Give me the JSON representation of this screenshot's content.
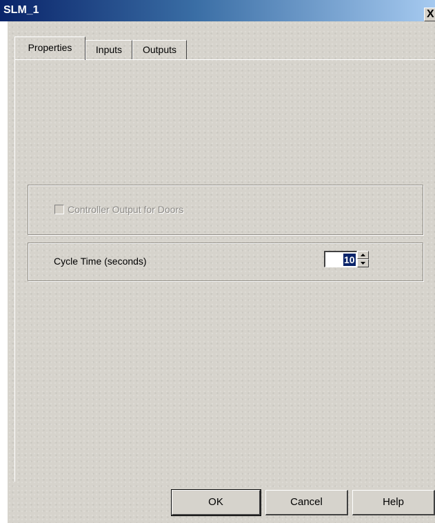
{
  "window": {
    "title": "SLM_1",
    "close_symbol": "X"
  },
  "tabs": [
    {
      "label": "Properties",
      "active": true
    },
    {
      "label": "Inputs",
      "active": false
    },
    {
      "label": "Outputs",
      "active": false
    }
  ],
  "properties": {
    "controller_output_label": "Controller Output for Doors",
    "controller_output_checked": false,
    "controller_output_enabled": false,
    "cycle_time_label": "Cycle Time (seconds)",
    "cycle_time_value": "10"
  },
  "buttons": {
    "ok": "OK",
    "cancel": "Cancel",
    "help": "Help"
  },
  "icons": {
    "spin_up": "triangle-up-icon",
    "spin_down": "triangle-down-icon"
  }
}
